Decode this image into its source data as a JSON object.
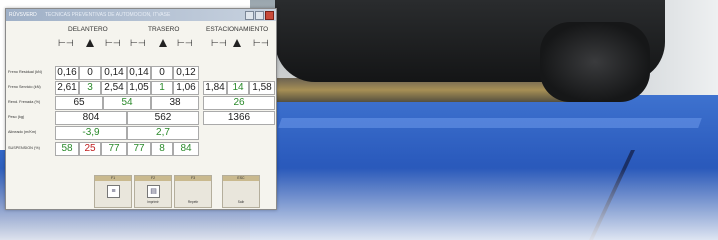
{
  "window": {
    "title_left": "RÚVSVERD",
    "title_center": "TECNICAS PREVENTIVAS DE AUTOMOCION, ITVASE",
    "groups": [
      "DELANTERO",
      "TRASERO",
      "ESTACIONAMIENTO"
    ]
  },
  "icons": {
    "axle_icon": "axle-icon",
    "warning_icon": "warning-icon"
  },
  "rows": {
    "freno_residual": {
      "label": "Freno Residual (kN)",
      "values": [
        "0,16",
        "0",
        "0,14",
        "0,14",
        "0",
        "0,12"
      ]
    },
    "freno_servicio": {
      "label": "Freno Servicio (kN)",
      "values": [
        "2,61",
        "3",
        "2,54",
        "1,05",
        "1",
        "1,06",
        "1,84",
        "14",
        "1,58"
      ]
    },
    "rend_frenada": {
      "label": "Rend. Frenada (%)",
      "values": [
        "65",
        "54",
        "38",
        "26"
      ]
    },
    "peso": {
      "label": "Peso (kg)",
      "values": [
        "804",
        "562",
        "1366"
      ]
    },
    "alineado": {
      "label": "Alineado (m/Km)",
      "values": [
        "-3,9",
        "2,7"
      ]
    },
    "suspension": {
      "label": "SUSPENSION (%)",
      "values": [
        "58",
        "25",
        "77",
        "77",
        "8",
        "84"
      ]
    }
  },
  "footer": {
    "buttons": [
      {
        "key": "F1",
        "label": ""
      },
      {
        "key": "F2",
        "label": "Imprimir"
      },
      {
        "key": "F3",
        "label": "Repetir"
      },
      {
        "key": "ESC",
        "label": "Salir"
      }
    ]
  },
  "colors": {
    "ok": "#2a8a2a",
    "bad": "#c02020",
    "plate": "#2b5bbd"
  }
}
